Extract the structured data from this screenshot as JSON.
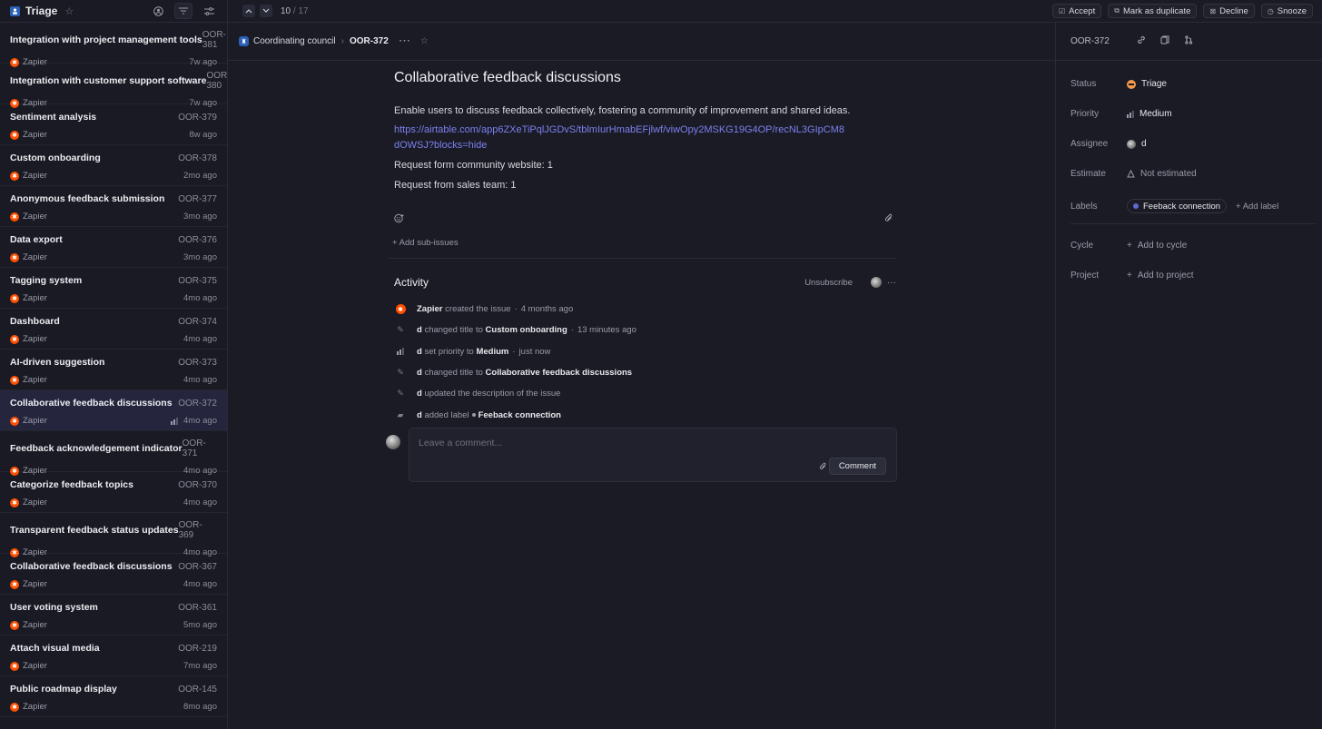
{
  "sidebar": {
    "title": "Triage",
    "issues": [
      {
        "title": "Integration with project management tools",
        "id": "OOR-381",
        "creator": "Zapier",
        "age": "7w ago"
      },
      {
        "title": "Integration with customer support software",
        "id": "OOR-380",
        "creator": "Zapier",
        "age": "7w ago"
      },
      {
        "title": "Sentiment analysis",
        "id": "OOR-379",
        "creator": "Zapier",
        "age": "8w ago"
      },
      {
        "title": "Custom onboarding",
        "id": "OOR-378",
        "creator": "Zapier",
        "age": "2mo ago"
      },
      {
        "title": "Anonymous feedback submission",
        "id": "OOR-377",
        "creator": "Zapier",
        "age": "3mo ago"
      },
      {
        "title": "Data export",
        "id": "OOR-376",
        "creator": "Zapier",
        "age": "3mo ago"
      },
      {
        "title": "Tagging system",
        "id": "OOR-375",
        "creator": "Zapier",
        "age": "4mo ago"
      },
      {
        "title": "Dashboard",
        "id": "OOR-374",
        "creator": "Zapier",
        "age": "4mo ago"
      },
      {
        "title": "AI-driven suggestion",
        "id": "OOR-373",
        "creator": "Zapier",
        "age": "4mo ago"
      },
      {
        "title": "Collaborative feedback discussions",
        "id": "OOR-372",
        "creator": "Zapier",
        "age": "4mo ago",
        "active": true
      },
      {
        "title": "Feedback acknowledgement indicator",
        "id": "OOR-371",
        "creator": "Zapier",
        "age": "4mo ago"
      },
      {
        "title": "Categorize feedback topics",
        "id": "OOR-370",
        "creator": "Zapier",
        "age": "4mo ago"
      },
      {
        "title": "Transparent feedback status updates",
        "id": "OOR-369",
        "creator": "Zapier",
        "age": "4mo ago"
      },
      {
        "title": "Collaborative feedback discussions",
        "id": "OOR-367",
        "creator": "Zapier",
        "age": "4mo ago"
      },
      {
        "title": "User voting system",
        "id": "OOR-361",
        "creator": "Zapier",
        "age": "5mo ago"
      },
      {
        "title": "Attach visual media",
        "id": "OOR-219",
        "creator": "Zapier",
        "age": "7mo ago"
      },
      {
        "title": "Public roadmap display",
        "id": "OOR-145",
        "creator": "Zapier",
        "age": "8mo ago"
      }
    ]
  },
  "topbar": {
    "position": "10",
    "total": "/ 17",
    "accept": "Accept",
    "duplicate": "Mark as duplicate",
    "decline": "Decline",
    "snooze": "Snooze"
  },
  "breadcrumb": {
    "team": "Coordinating council",
    "issue_id": "OOR-372"
  },
  "issue": {
    "title": "Collaborative feedback discussions",
    "description": "Enable users to discuss feedback collectively, fostering a community of improvement and shared ideas.",
    "link": "https://airtable.com/app6ZXeTiPqlJGDvS/tblmIurHmabEFjlwf/viwOpy2MSKG19G4OP/recNL3GIpCM8dOWSJ?blocks=hide",
    "line1": "Request form community website: 1",
    "line2": "Request from sales team: 1",
    "add_sub_issues": "+ Add sub-issues"
  },
  "activity": {
    "heading": "Activity",
    "unsubscribe": "Unsubscribe",
    "items": [
      {
        "actor": "Zapier",
        "text": "created the issue",
        "target": "",
        "time": "4 months ago"
      },
      {
        "actor": "d",
        "text": "changed title to",
        "target": "Custom onboarding",
        "time": "13 minutes ago"
      },
      {
        "actor": "d",
        "text": "set priority to",
        "target": "Medium",
        "time": "just now"
      },
      {
        "actor": "d",
        "text": "changed title to",
        "target": "Collaborative feedback discussions",
        "time": ""
      },
      {
        "actor": "d",
        "text": "updated the description of the issue",
        "target": "",
        "time": ""
      },
      {
        "actor": "d",
        "text": "added label",
        "target": "Feeback connection",
        "time": ""
      }
    ],
    "comment_placeholder": "Leave a comment...",
    "comment_button": "Comment"
  },
  "panel": {
    "issue_id": "OOR-372",
    "status_label": "Status",
    "status": "Triage",
    "priority_label": "Priority",
    "priority": "Medium",
    "assignee_label": "Assignee",
    "assignee": "d",
    "estimate_label": "Estimate",
    "estimate": "Not estimated",
    "labels_label": "Labels",
    "label_chip": "Feeback connection",
    "add_label": "+ Add label",
    "cycle_label": "Cycle",
    "cycle": "Add to cycle",
    "project_label": "Project",
    "project": "Add to project"
  },
  "colors": {
    "background": "#1a1b24",
    "accent": "#5e6ad2",
    "link": "#7c80f0",
    "zapier": "#ff4f00",
    "triage": "#f2994a"
  }
}
